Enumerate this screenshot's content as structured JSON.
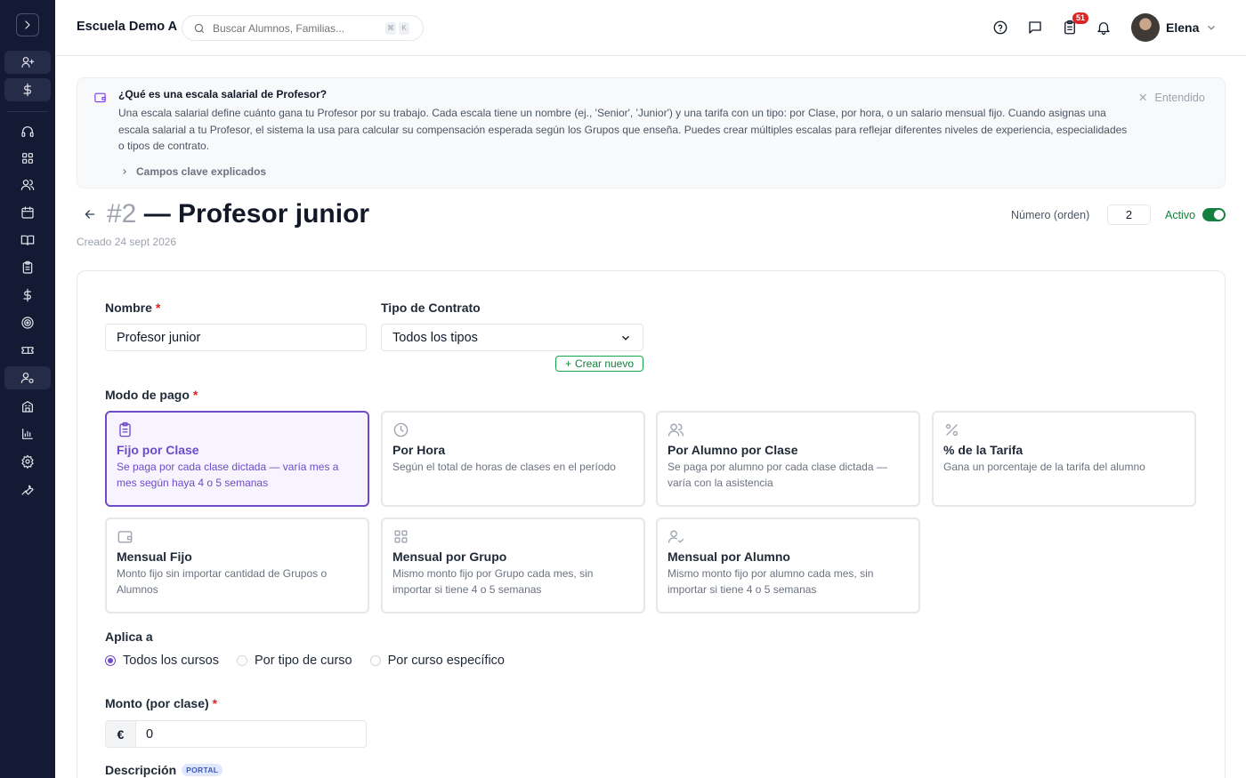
{
  "topbar": {
    "school_name": "Escuela Demo A",
    "search_placeholder": "Buscar Alumnos, Familias...",
    "shortcut_key_1": "⌘",
    "shortcut_key_2": "K",
    "tasks_badge": "51",
    "user_name": "Elena"
  },
  "info": {
    "title": "¿Qué es una escala salarial de Profesor?",
    "text": "Una escala salarial define cuánto gana tu Profesor por su trabajo. Cada escala tiene un nombre (ej., 'Senior', 'Junior') y una tarifa con un tipo: por Clase, por hora, o un salario mensual fijo. Cuando asignas una escala salarial a tu Profesor, el sistema la usa para calcular su compensación esperada según los Grupos que enseña. Puedes crear múltiples escalas para reflejar diferentes niveles de experiencia, especialidades o tipos de contrato.",
    "dismiss_label": "Entendido",
    "expand_label": "Campos clave explicados"
  },
  "header": {
    "number": "#2",
    "title": " — Profesor junior",
    "created": "Creado 24 sept 2026",
    "order_label": "Número (orden)",
    "order_value": "2",
    "active_label": "Activo"
  },
  "form": {
    "name_label": "Nombre",
    "name_value": "Profesor junior",
    "contract_label": "Tipo de Contrato",
    "contract_value": "Todos los tipos",
    "create_new_label": "Crear nuevo",
    "mode_label": "Modo de pago",
    "modes": [
      {
        "title": "Fijo por Clase",
        "desc": "Se paga por cada clase dictada — varía mes a mes según haya 4 o 5 semanas",
        "icon": "clipboard-icon"
      },
      {
        "title": "Por Hora",
        "desc": "Según el total de horas de clases en el período",
        "icon": "clock-icon"
      },
      {
        "title": "Por Alumno por Clase",
        "desc": "Se paga por alumno por cada clase dictada — varía con la asistencia",
        "icon": "users-icon"
      },
      {
        "title": "% de la Tarifa",
        "desc": "Gana un porcentaje de la tarifa del alumno",
        "icon": "percent-icon"
      },
      {
        "title": "Mensual Fijo",
        "desc": "Monto fijo sin importar cantidad de Grupos o Alumnos",
        "icon": "wallet-icon"
      },
      {
        "title": "Mensual por Grupo",
        "desc": "Mismo monto fijo por Grupo cada mes, sin importar si tiene 4 o 5 semanas",
        "icon": "grid-icon"
      },
      {
        "title": "Mensual por Alumno",
        "desc": "Mismo monto fijo por alumno cada mes, sin importar si tiene 4 o 5 semanas",
        "icon": "user-check-icon"
      }
    ],
    "applies_label": "Aplica a",
    "applies_options": [
      "Todos los cursos",
      "Por tipo de curso",
      "Por curso específico"
    ],
    "amount_label": "Monto (por clase)",
    "currency": "€",
    "amount_value": "0",
    "description_label": "Descripción",
    "portal_badge": "PORTAL"
  },
  "colors": {
    "sidebar_bg": "#141a33",
    "accent": "#6d4ac8",
    "active_green": "#15803d",
    "badge_red": "#dc2626"
  }
}
